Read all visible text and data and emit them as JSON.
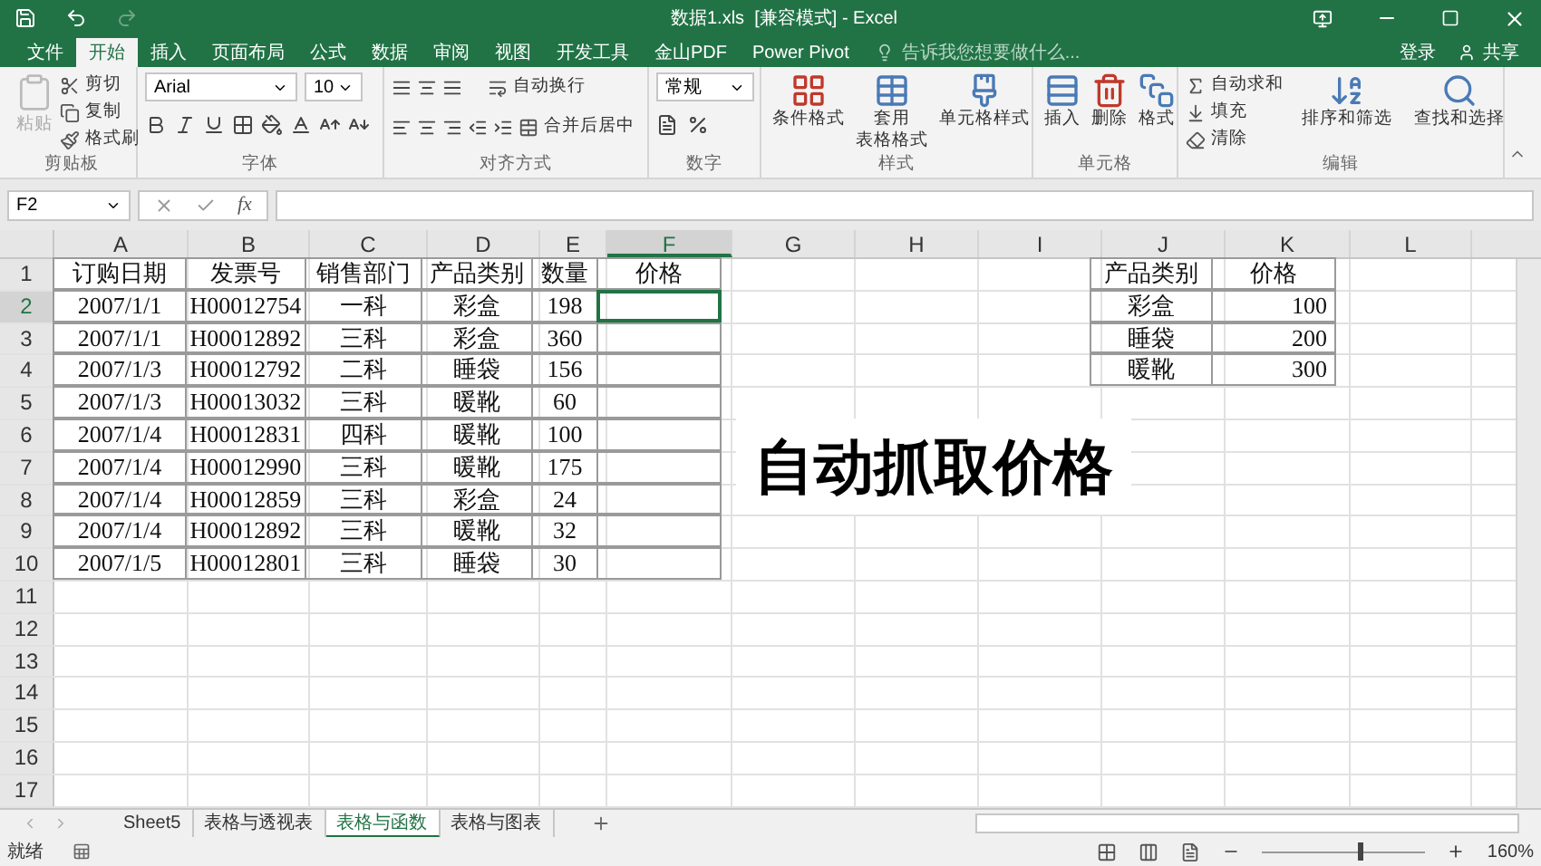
{
  "window": {
    "title": "数据1.xls  [兼容模式] - Excel"
  },
  "menu_tabs": [
    {
      "label": "文件",
      "selected": false
    },
    {
      "label": "开始",
      "selected": true
    },
    {
      "label": "插入",
      "selected": false
    },
    {
      "label": "页面布局",
      "selected": false
    },
    {
      "label": "公式",
      "selected": false
    },
    {
      "label": "数据",
      "selected": false
    },
    {
      "label": "审阅",
      "selected": false
    },
    {
      "label": "视图",
      "selected": false
    },
    {
      "label": "开发工具",
      "selected": false
    },
    {
      "label": "金山PDF",
      "selected": false
    },
    {
      "label": "Power Pivot",
      "selected": false
    }
  ],
  "tell_me": {
    "placeholder": "告诉我您想要做什么..."
  },
  "account": {
    "sign_in": "登录",
    "share": "共享"
  },
  "ribbon": [
    {
      "kind": "clipboard",
      "label": "剪贴板",
      "paste": {
        "label": "粘贴",
        "disabled": true
      },
      "items": [
        "剪切",
        "复制",
        "格式刷"
      ]
    },
    {
      "kind": "font",
      "label": "字体",
      "font_name": "Arial",
      "font_size": "10"
    },
    {
      "kind": "alignment",
      "label": "对齐方式",
      "wrap": "自动换行",
      "merge": "合并后居中"
    },
    {
      "kind": "number",
      "label": "数字",
      "format": "常规"
    },
    {
      "kind": "buttons",
      "label": "样式",
      "items": [
        [
          "条件格式"
        ],
        [
          "套用",
          "表格格式"
        ],
        [
          "单元格样式"
        ]
      ]
    },
    {
      "kind": "buttons",
      "label": "单元格",
      "items": [
        [
          "插入"
        ],
        [
          "删除"
        ],
        [
          "格式"
        ]
      ]
    },
    {
      "kind": "editing",
      "label": "编辑",
      "small": [
        "自动求和",
        "填充",
        "清除"
      ],
      "large": [
        [
          "排序和筛选"
        ],
        [
          "查找和选择"
        ]
      ]
    }
  ],
  "formula_bar": {
    "name_box": "F2",
    "fx": "fx"
  },
  "sheet": {
    "columns": [
      {
        "label": "A",
        "selected": false
      },
      {
        "label": "B",
        "selected": false
      },
      {
        "label": "C",
        "selected": false
      },
      {
        "label": "D",
        "selected": false
      },
      {
        "label": "E",
        "selected": false
      },
      {
        "label": "F",
        "selected": true
      },
      {
        "label": "G",
        "selected": false
      },
      {
        "label": "H",
        "selected": false
      },
      {
        "label": "I",
        "selected": false
      },
      {
        "label": "J",
        "selected": false
      },
      {
        "label": "K",
        "selected": false
      },
      {
        "label": "L",
        "selected": false
      }
    ],
    "rows": [
      {
        "header": "1",
        "selected": false
      },
      {
        "header": "2",
        "selected": true
      },
      {
        "header": "3",
        "selected": false
      },
      {
        "header": "4",
        "selected": false
      },
      {
        "header": "5",
        "selected": false
      },
      {
        "header": "6",
        "selected": false
      },
      {
        "header": "7",
        "selected": false
      },
      {
        "header": "8",
        "selected": false
      },
      {
        "header": "9",
        "selected": false
      },
      {
        "header": "10",
        "selected": false
      },
      {
        "header": "11",
        "selected": false
      },
      {
        "header": "12",
        "selected": false
      },
      {
        "header": "13",
        "selected": false
      },
      {
        "header": "14",
        "selected": false
      },
      {
        "header": "15",
        "selected": false
      },
      {
        "header": "16",
        "selected": false
      },
      {
        "header": "17",
        "selected": false
      }
    ]
  },
  "orders_table": {
    "header": [
      "订购日期",
      "发票号",
      "销售部门",
      "产品类别",
      "数量",
      "价格"
    ],
    "rows": [
      [
        "2007/1/1",
        "H00012754",
        "一科",
        "彩盒",
        "198",
        null
      ],
      [
        "2007/1/1",
        "H00012892",
        "三科",
        "彩盒",
        "360",
        null
      ],
      [
        "2007/1/3",
        "H00012792",
        "二科",
        "睡袋",
        "156",
        null
      ],
      [
        "2007/1/3",
        "H00013032",
        "三科",
        "暖靴",
        "60",
        null
      ],
      [
        "2007/1/4",
        "H00012831",
        "四科",
        "暖靴",
        "100",
        null
      ],
      [
        "2007/1/4",
        "H00012990",
        "三科",
        "暖靴",
        "175",
        null
      ],
      [
        "2007/1/4",
        "H00012859",
        "三科",
        "彩盒",
        "24",
        null
      ],
      [
        "2007/1/4",
        "H00012892",
        "三科",
        "暖靴",
        "32",
        null
      ],
      [
        "2007/1/5",
        "H00012801",
        "三科",
        "睡袋",
        "30",
        null
      ]
    ]
  },
  "price_table": {
    "header": [
      "产品类别",
      "价格"
    ],
    "rows": [
      [
        "彩盒",
        "100"
      ],
      [
        "睡袋",
        "200"
      ],
      [
        "暖靴",
        "300"
      ]
    ]
  },
  "caption": "自动抓取价格",
  "sheet_tabs": [
    {
      "label": "Sheet5",
      "selected": false
    },
    {
      "label": "表格与透视表",
      "selected": false
    },
    {
      "label": "表格与函数",
      "selected": true
    },
    {
      "label": "表格与图表",
      "selected": false
    }
  ],
  "status_bar": {
    "text": "就绪",
    "zoom": {
      "reading": "160%",
      "level": 0.6
    }
  }
}
